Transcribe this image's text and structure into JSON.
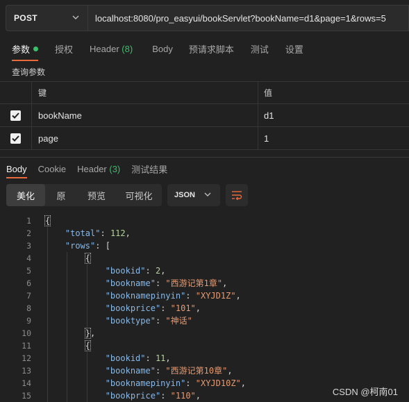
{
  "request": {
    "method": "POST",
    "url": "localhost:8080/pro_easyui/bookServlet?bookName=d1&page=1&rows=5"
  },
  "request_tabs": [
    {
      "label": "参数",
      "active": true,
      "dot": true
    },
    {
      "label": "授权"
    },
    {
      "label": "Header",
      "count": "(8)"
    },
    {
      "label": "Body"
    },
    {
      "label": "预请求脚本"
    },
    {
      "label": "测试"
    },
    {
      "label": "设置"
    }
  ],
  "query_params": {
    "title": "查询参数",
    "headers": {
      "key": "键",
      "value": "值"
    },
    "rows": [
      {
        "checked": true,
        "key": "bookName",
        "value": "d1"
      },
      {
        "checked": true,
        "key": "page",
        "value": "1"
      }
    ]
  },
  "response_tabs": [
    {
      "label": "Body",
      "active": true
    },
    {
      "label": "Cookie"
    },
    {
      "label": "Header",
      "count": "(3)"
    },
    {
      "label": "测试结果"
    }
  ],
  "view_modes": [
    {
      "label": "美化",
      "active": true
    },
    {
      "label": "原"
    },
    {
      "label": "预览"
    },
    {
      "label": "可视化"
    }
  ],
  "format_select": {
    "value": "JSON"
  },
  "code_lines": [
    {
      "num": "1",
      "text": "{"
    },
    {
      "num": "2",
      "text": "    \"total\": 112,"
    },
    {
      "num": "3",
      "text": "    \"rows\": ["
    },
    {
      "num": "4",
      "text": "        {"
    },
    {
      "num": "5",
      "text": "            \"bookid\": 2,"
    },
    {
      "num": "6",
      "text": "            \"bookname\": \"西游记第1章\","
    },
    {
      "num": "7",
      "text": "            \"booknamepinyin\": \"XYJD1Z\","
    },
    {
      "num": "8",
      "text": "            \"bookprice\": \"101\","
    },
    {
      "num": "9",
      "text": "            \"booktype\": \"神话\""
    },
    {
      "num": "10",
      "text": "        },"
    },
    {
      "num": "11",
      "text": "        {"
    },
    {
      "num": "12",
      "text": "            \"bookid\": 11,"
    },
    {
      "num": "13",
      "text": "            \"bookname\": \"西游记第10章\","
    },
    {
      "num": "14",
      "text": "            \"booknamepinyin\": \"XYJD10Z\","
    },
    {
      "num": "15",
      "text": "            \"bookprice\": \"110\","
    }
  ],
  "watermark": "CSDN @柯南01",
  "colors": {
    "accent": "#e96a3a",
    "success": "#3bbf6b",
    "json_key": "#88b9e8",
    "json_string": "#e69b72",
    "json_number": "#b5d39a"
  }
}
